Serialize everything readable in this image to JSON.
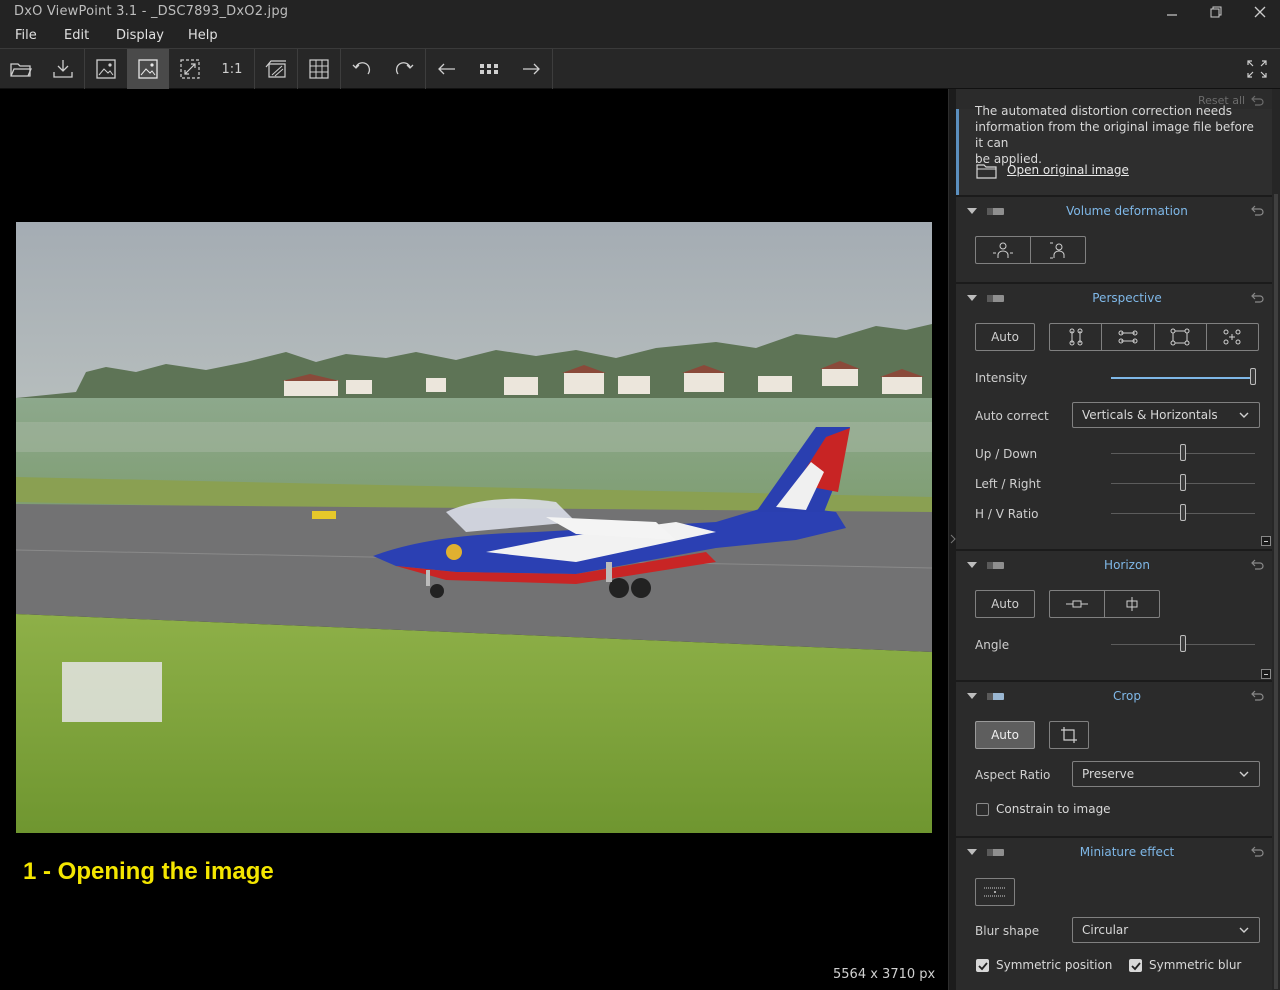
{
  "window": {
    "title": "DxO ViewPoint 3.1 - _DSC7893_DxO2.jpg"
  },
  "menu": {
    "file": "File",
    "edit": "Edit",
    "display": "Display",
    "help": "Help"
  },
  "toolbar": {
    "items": [
      "open-folder-icon",
      "export-icon",
      "original-image-icon",
      "corrected-image-icon",
      "fit-screen-icon",
      "one-to-one",
      "side-by-side-icon",
      "grid-icon",
      "rotate-left-icon",
      "rotate-right-icon",
      "previous-icon",
      "thumbnails-icon",
      "next-icon"
    ],
    "one_to_one_label": "1:1",
    "active": "corrected-image-icon"
  },
  "viewer": {
    "caption": "1 - Opening the image",
    "dimensions": "5564 x 3710 px",
    "photo_description_colors": {
      "sky": "#a8b0b6",
      "grass": "#7ea23a",
      "runway": "#6f6f70",
      "jet_blue": "#2a3fb0",
      "jet_red": "#c62222"
    }
  },
  "panel": {
    "reset_all": "Reset all",
    "distortion_notice": {
      "text_line1": "The automated distortion correction needs",
      "text_line2": "information from the original image file before it can",
      "text_line3": "be applied.",
      "open_link": "Open original image"
    },
    "volume": {
      "title": "Volume deformation"
    },
    "perspective": {
      "title": "Perspective",
      "auto": "Auto",
      "intensity_label": "Intensity",
      "intensity_value": 1.0,
      "auto_correct_label": "Auto correct",
      "auto_correct_value": "Verticals & Horizontals",
      "up_down_label": "Up / Down",
      "up_down_value": 0.5,
      "left_right_label": "Left / Right",
      "left_right_value": 0.5,
      "hv_ratio_label": "H / V Ratio",
      "hv_ratio_value": 0.5
    },
    "horizon": {
      "title": "Horizon",
      "auto": "Auto",
      "angle_label": "Angle",
      "angle_value": 0.5
    },
    "crop": {
      "title": "Crop",
      "auto": "Auto",
      "aspect_label": "Aspect Ratio",
      "aspect_value": "Preserve",
      "constrain_label": "Constrain to image",
      "constrain_checked": false
    },
    "miniature": {
      "title": "Miniature effect",
      "blur_shape_label": "Blur shape",
      "blur_shape_value": "Circular",
      "symmetric_position_label": "Symmetric position",
      "symmetric_position_checked": true,
      "symmetric_blur_label": "Symmetric blur",
      "symmetric_blur_checked": true
    },
    "accent_color": "#7fb8e8"
  }
}
